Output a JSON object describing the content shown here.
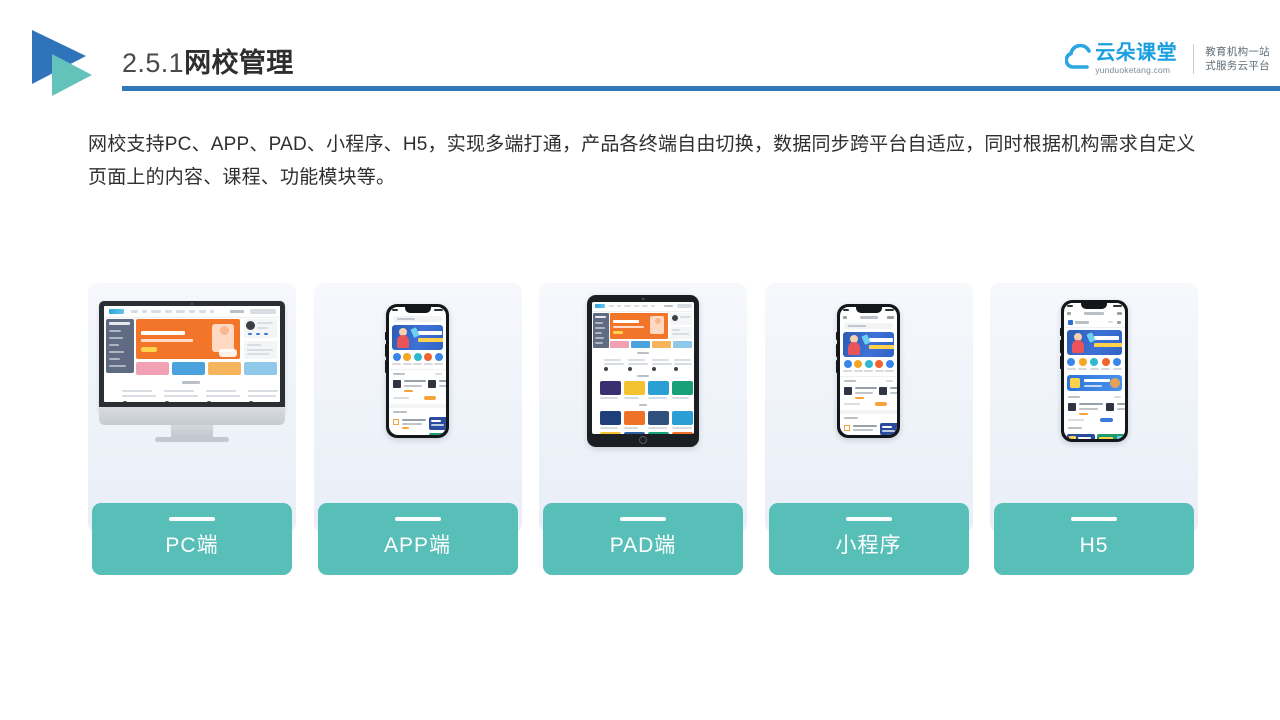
{
  "header": {
    "logo_icon": "double-triangle-logo",
    "title_number": "2.5.1",
    "title_text": "网校管理",
    "brand": {
      "cloud_icon": "cloud-icon",
      "name_cn": "云朵课堂",
      "name_en": "yunduoketang.com",
      "slogan_line1": "教育机构一站",
      "slogan_line2": "式服务云平台"
    },
    "rule_color": "#3277ba"
  },
  "body": {
    "paragraph": "网校支持PC、APP、PAD、小程序、H5，实现多端打通，产品各终端自由切换，数据同步跨平台自适应，同时根据机构需求自定义页面上的内容、课程、功能模块等。"
  },
  "cards": [
    {
      "id": "pc",
      "label": "PC端",
      "device_icon": "desktop-monitor-icon",
      "device_type": "imac"
    },
    {
      "id": "app",
      "label": "APP端",
      "device_icon": "smartphone-icon",
      "device_type": "iphone"
    },
    {
      "id": "pad",
      "label": "PAD端",
      "device_icon": "tablet-icon",
      "device_type": "ipad"
    },
    {
      "id": "miniprogram",
      "label": "小程序",
      "device_icon": "smartphone-icon",
      "device_type": "iphone"
    },
    {
      "id": "h5",
      "label": "H5",
      "device_icon": "smartphone-icon",
      "device_type": "iphone"
    }
  ],
  "colors": {
    "accent_teal": "#58bfb8",
    "accent_blue": "#3277ba",
    "logo_blue": "#2f74bb",
    "logo_teal": "#63c3bb",
    "brand_blue": "#1a9fe0",
    "card_bg": "#eef2f9"
  }
}
